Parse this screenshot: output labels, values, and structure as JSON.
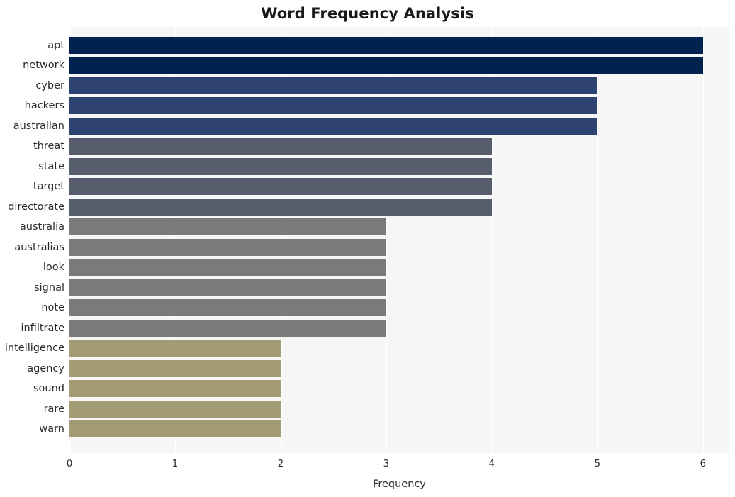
{
  "chart_data": {
    "type": "bar",
    "orientation": "horizontal",
    "title": "Word Frequency Analysis",
    "xlabel": "Frequency",
    "ylabel": "",
    "xlim": [
      0,
      6.25
    ],
    "xticks": [
      0,
      1,
      2,
      3,
      4,
      5,
      6
    ],
    "xtick_labels": [
      "0",
      "1",
      "2",
      "3",
      "4",
      "5",
      "6"
    ],
    "grid": "vertical-only",
    "legend": "none",
    "categories": [
      "apt",
      "network",
      "cyber",
      "hackers",
      "australian",
      "threat",
      "state",
      "target",
      "directorate",
      "australia",
      "australias",
      "look",
      "signal",
      "note",
      "infiltrate",
      "intelligence",
      "agency",
      "sound",
      "rare",
      "warn"
    ],
    "values": [
      6,
      6,
      5,
      5,
      5,
      4,
      4,
      4,
      4,
      3,
      3,
      3,
      3,
      3,
      3,
      2,
      2,
      2,
      2,
      2
    ],
    "bar_colors": [
      "#00224e",
      "#00224e",
      "#2e4372",
      "#2e4372",
      "#2e4372",
      "#575d6d",
      "#575d6d",
      "#575d6d",
      "#575d6d",
      "#7b7a78",
      "#7b7a78",
      "#7b7a78",
      "#7b7a78",
      "#7b7a78",
      "#7b7a78",
      "#a39b72",
      "#a39b72",
      "#a39b72",
      "#a39b72",
      "#a39b72"
    ],
    "palette_note": "cividis-like sequential palette mapped to frequency value",
    "plot_background": "#f6f6f7",
    "gridline_color": "#ffffff",
    "figure_background": "#ffffff",
    "text_color": "#2b2b2b"
  }
}
